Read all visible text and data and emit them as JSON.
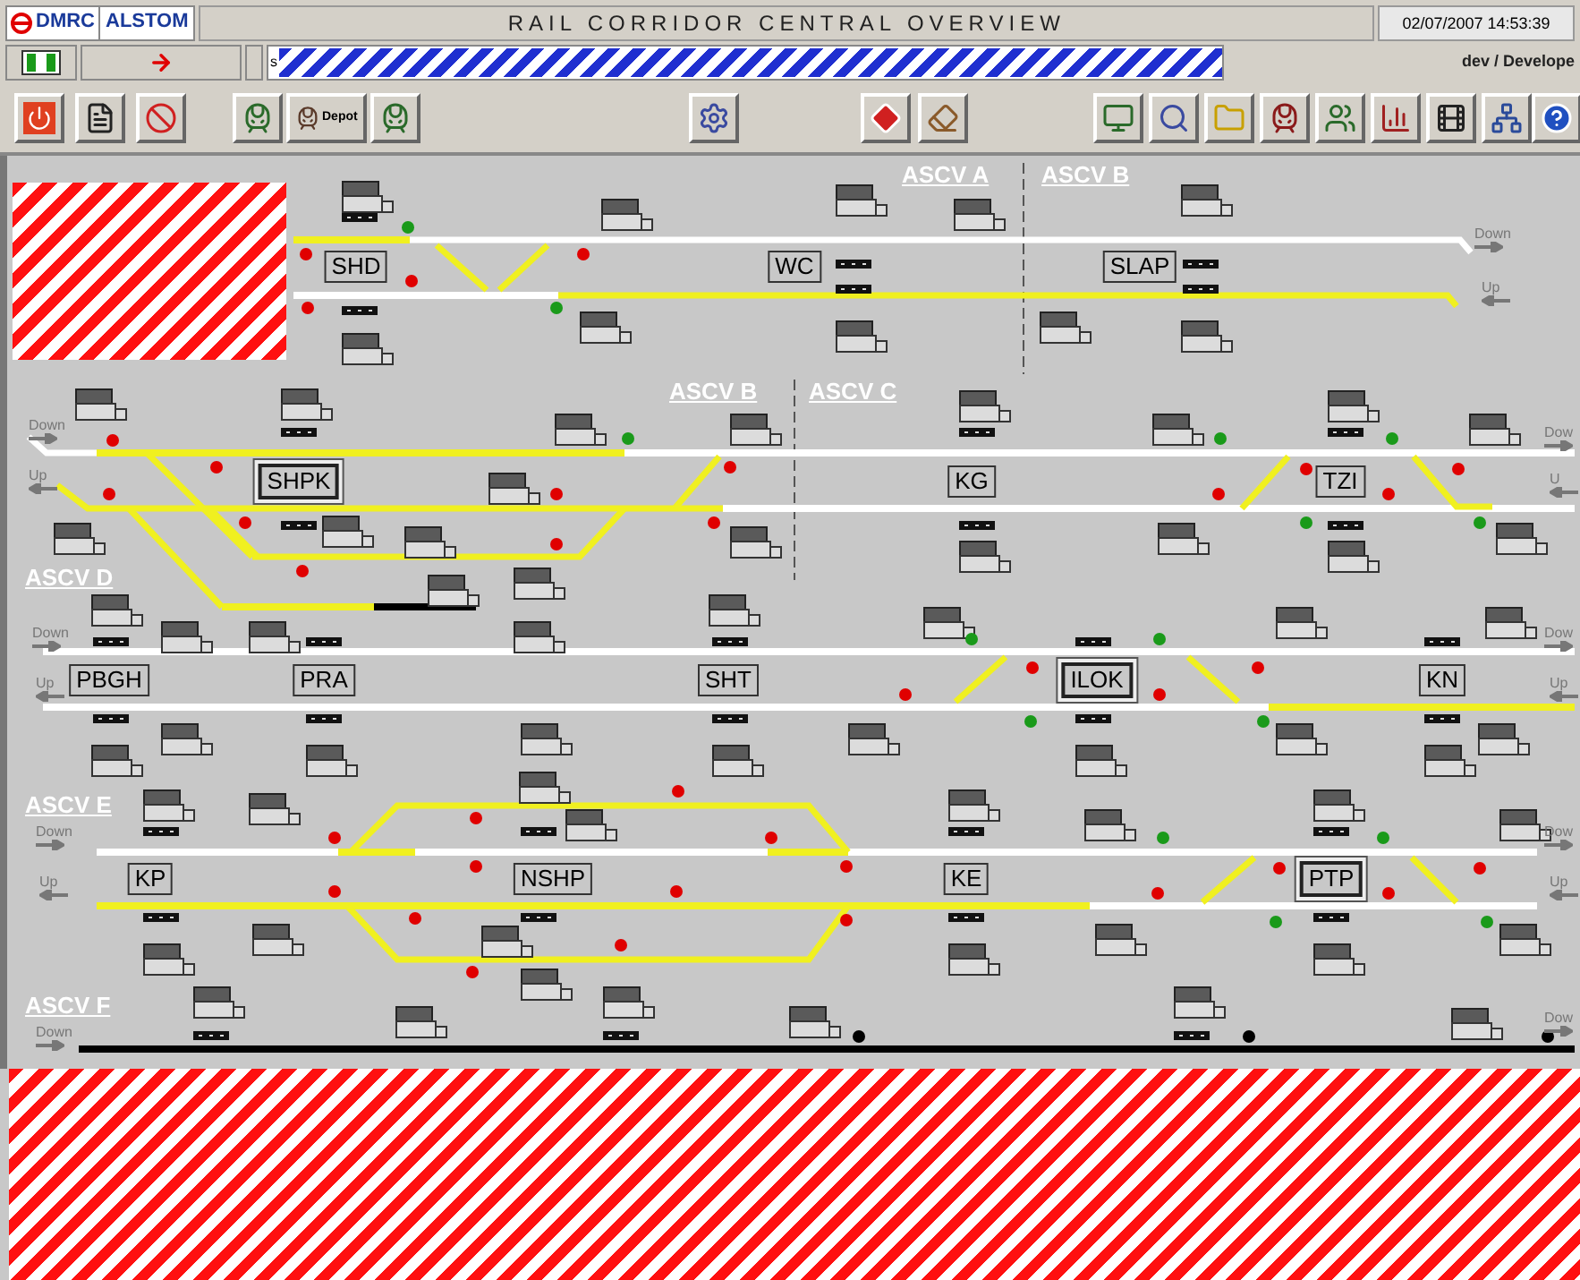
{
  "header": {
    "logos": [
      "DMRC",
      "ALSTOM"
    ],
    "title": "RAIL CORRIDOR CENTRAL OVERVIEW",
    "datetime": "02/07/2007 14:53:39",
    "field_prefix": "s",
    "user": "dev / Develope",
    "depot_label": "Depot"
  },
  "sectors": [
    "ASCV A",
    "ASCV B",
    "ASCV B",
    "ASCV C",
    "ASCV D",
    "ASCV E",
    "ASCV F"
  ],
  "stations": [
    {
      "name": "SHD",
      "framed": false
    },
    {
      "name": "WC",
      "framed": false
    },
    {
      "name": "SLAP",
      "framed": false
    },
    {
      "name": "SHPK",
      "framed": true
    },
    {
      "name": "KG",
      "framed": false
    },
    {
      "name": "TZI",
      "framed": false
    },
    {
      "name": "PBGH",
      "framed": false
    },
    {
      "name": "PRA",
      "framed": false
    },
    {
      "name": "SHT",
      "framed": false
    },
    {
      "name": "ILOK",
      "framed": true
    },
    {
      "name": "KN",
      "framed": false
    },
    {
      "name": "KP",
      "framed": false
    },
    {
      "name": "NSHP",
      "framed": false
    },
    {
      "name": "KE",
      "framed": false
    },
    {
      "name": "PTP",
      "framed": true
    }
  ],
  "directions": [
    {
      "text": "Down",
      "kind": "down"
    },
    {
      "text": "Up",
      "kind": "up"
    },
    {
      "text": "Down",
      "kind": "down"
    },
    {
      "text": "Up",
      "kind": "up"
    },
    {
      "text": "Dow",
      "kind": "down"
    },
    {
      "text": "U",
      "kind": "up"
    },
    {
      "text": "Down",
      "kind": "down"
    },
    {
      "text": "Up",
      "kind": "up"
    },
    {
      "text": "Dow",
      "kind": "down"
    },
    {
      "text": "Up",
      "kind": "up"
    },
    {
      "text": "Down",
      "kind": "down"
    },
    {
      "text": "Up",
      "kind": "up"
    },
    {
      "text": "Dow",
      "kind": "down"
    },
    {
      "text": "Up",
      "kind": "up"
    },
    {
      "text": "Down",
      "kind": "down"
    },
    {
      "text": "Dow",
      "kind": "down"
    }
  ],
  "tracks": [
    {
      "color": "#f0f020"
    },
    {
      "color": "#ffffff"
    },
    {
      "color": "#ffffff"
    },
    {
      "color": "#f0f020"
    },
    {
      "color": "#f0f020"
    },
    {
      "color": "#f0f020"
    },
    {
      "color": "#ffffff"
    },
    {
      "color": "#f0f020"
    },
    {
      "color": "#ffffff"
    },
    {
      "color": "#f0f020"
    },
    {
      "color": "#ffffff"
    },
    {
      "color": "#f0f020"
    },
    {
      "color": "#f0f020"
    },
    {
      "color": "#f0f020"
    },
    {
      "color": "#f0f020"
    },
    {
      "color": "#f0f020"
    },
    {
      "color": "#000000"
    },
    {
      "color": "#f0f020"
    },
    {
      "color": "#f0f020"
    },
    {
      "color": "#f0f020"
    },
    {
      "color": "#ffffff"
    },
    {
      "color": "#ffffff"
    },
    {
      "color": "#f0f020"
    },
    {
      "color": "#f0f020"
    },
    {
      "color": "#f0f020"
    },
    {
      "color": "#ffffff"
    },
    {
      "color": "#f0f020"
    },
    {
      "color": "#ffffff"
    },
    {
      "color": "#f0f020"
    },
    {
      "color": "#ffffff"
    },
    {
      "color": "#f0f020"
    },
    {
      "color": "#ffffff"
    },
    {
      "color": "#f0f020"
    },
    {
      "color": "#f0f020"
    },
    {
      "color": "#f0f020"
    },
    {
      "color": "#f0f020"
    },
    {
      "color": "#000000"
    }
  ],
  "signals": [
    {
      "color": "#1a9a1a"
    },
    {
      "color": "#e00000"
    },
    {
      "color": "#e00000"
    },
    {
      "color": "#e00000"
    },
    {
      "color": "#1a9a1a"
    },
    {
      "color": "#e00000"
    },
    {
      "color": "#e00000"
    },
    {
      "color": "#e00000"
    },
    {
      "color": "#e00000"
    },
    {
      "color": "#e00000"
    },
    {
      "color": "#1a9a1a"
    },
    {
      "color": "#e00000"
    },
    {
      "color": "#e00000"
    },
    {
      "color": "#e00000"
    },
    {
      "color": "#e00000"
    },
    {
      "color": "#e00000"
    },
    {
      "color": "#1a9a1a"
    },
    {
      "color": "#e00000"
    },
    {
      "color": "#e00000"
    },
    {
      "color": "#1a9a1a"
    },
    {
      "color": "#1a9a1a"
    },
    {
      "color": "#e00000"
    },
    {
      "color": "#e00000"
    },
    {
      "color": "#1a9a1a"
    },
    {
      "color": "#1a9a1a"
    },
    {
      "color": "#e00000"
    },
    {
      "color": "#e00000"
    },
    {
      "color": "#1a9a1a"
    },
    {
      "color": "#1a9a1a"
    },
    {
      "color": "#e00000"
    },
    {
      "color": "#e00000"
    },
    {
      "color": "#1a9a1a"
    },
    {
      "color": "#e00000"
    },
    {
      "color": "#e00000"
    },
    {
      "color": "#e00000"
    },
    {
      "color": "#e00000"
    },
    {
      "color": "#e00000"
    },
    {
      "color": "#e00000"
    },
    {
      "color": "#e00000"
    },
    {
      "color": "#e00000"
    },
    {
      "color": "#e00000"
    },
    {
      "color": "#e00000"
    },
    {
      "color": "#e00000"
    },
    {
      "color": "#e00000"
    },
    {
      "color": "#1a9a1a"
    },
    {
      "color": "#e00000"
    },
    {
      "color": "#e00000"
    },
    {
      "color": "#1a9a1a"
    },
    {
      "color": "#1a9a1a"
    },
    {
      "color": "#e00000"
    },
    {
      "color": "#e00000"
    },
    {
      "color": "#1a9a1a"
    },
    {
      "color": "#000000"
    },
    {
      "color": "#000000"
    },
    {
      "color": "#000000"
    }
  ]
}
